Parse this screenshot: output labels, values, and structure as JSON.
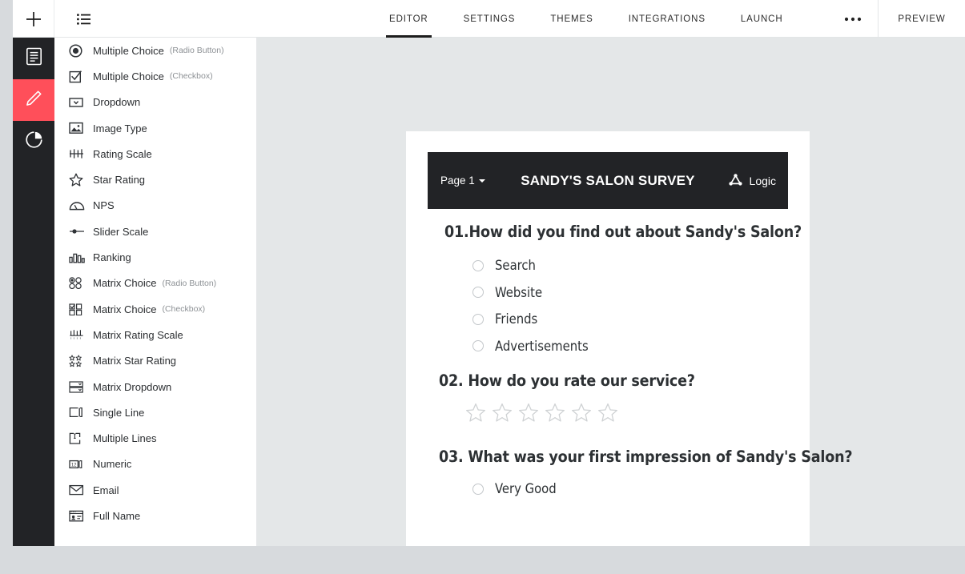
{
  "topbar": {
    "add_icon": "plus-icon",
    "list_icon": "list-icon",
    "more_label": "•••",
    "preview_label": "PREVIEW",
    "tabs": [
      {
        "label": "EDITOR",
        "active": true
      },
      {
        "label": "SETTINGS",
        "active": false
      },
      {
        "label": "THEMES",
        "active": false
      },
      {
        "label": "INTEGRATIONS",
        "active": false
      },
      {
        "label": "LAUNCH",
        "active": false
      }
    ]
  },
  "rail": {
    "items": [
      {
        "name": "document-icon",
        "active": false
      },
      {
        "name": "pencil-icon",
        "active": true
      },
      {
        "name": "pie-chart-icon",
        "active": false
      }
    ],
    "active_color": "#ff4f5a",
    "background": "#222326"
  },
  "element_panel": {
    "items": [
      {
        "label": "Multiple Choice",
        "sub": "(Radio Button)",
        "icon": "radio-filled-icon"
      },
      {
        "label": "Multiple Choice",
        "sub": "(Checkbox)",
        "icon": "checkbox-check-icon"
      },
      {
        "label": "Dropdown",
        "sub": "",
        "icon": "dropdown-icon"
      },
      {
        "label": "Image Type",
        "sub": "",
        "icon": "image-icon"
      },
      {
        "label": "Rating Scale",
        "sub": "",
        "icon": "rating-scale-icon"
      },
      {
        "label": "Star Rating",
        "sub": "",
        "icon": "star-icon"
      },
      {
        "label": "NPS",
        "sub": "",
        "icon": "nps-gauge-icon"
      },
      {
        "label": "Slider Scale",
        "sub": "",
        "icon": "slider-icon"
      },
      {
        "label": "Ranking",
        "sub": "",
        "icon": "ranking-bars-icon"
      },
      {
        "label": "Matrix Choice",
        "sub": "(Radio Button)",
        "icon": "matrix-radio-icon"
      },
      {
        "label": "Matrix Choice",
        "sub": "(Checkbox)",
        "icon": "matrix-checkbox-icon"
      },
      {
        "label": "Matrix Rating Scale",
        "sub": "",
        "icon": "matrix-rating-icon"
      },
      {
        "label": "Matrix Star Rating",
        "sub": "",
        "icon": "matrix-star-icon"
      },
      {
        "label": "Matrix Dropdown",
        "sub": "",
        "icon": "matrix-dropdown-icon"
      },
      {
        "label": "Single Line",
        "sub": "",
        "icon": "single-line-icon"
      },
      {
        "label": "Multiple Lines",
        "sub": "",
        "icon": "multiple-lines-icon"
      },
      {
        "label": "Numeric",
        "sub": "",
        "icon": "numeric-icon"
      },
      {
        "label": "Email",
        "sub": "",
        "icon": "envelope-icon"
      },
      {
        "label": "Full Name",
        "sub": "",
        "icon": "full-name-icon"
      }
    ]
  },
  "survey": {
    "page_selector": "Page 1",
    "title": "SANDY'S SALON SURVEY",
    "logic_label": "Logic",
    "logic_icon": "logic-triangle-icon",
    "header_background": "#222326",
    "questions": [
      {
        "number": "01.",
        "text": "How did you find out about Sandy's Salon?",
        "type": "radio",
        "options": [
          "Search",
          "Website",
          "Friends",
          "Advertisements"
        ]
      },
      {
        "number": "02. ",
        "text": "How do you rate our service?",
        "type": "star",
        "star_count": 6,
        "stars_filled": 0
      },
      {
        "number": "03. ",
        "text": "What was your first impression of Sandy's Salon?",
        "type": "radio",
        "options": [
          "Very Good"
        ]
      }
    ]
  }
}
